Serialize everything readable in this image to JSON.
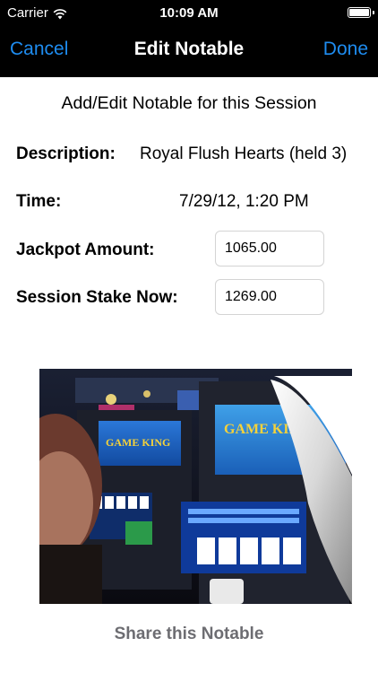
{
  "status_bar": {
    "carrier": "Carrier",
    "time": "10:09 AM",
    "battery_level": 1.0
  },
  "nav": {
    "cancel_label": "Cancel",
    "title": "Edit Notable",
    "done_label": "Done",
    "accent_color": "#1e8cf0"
  },
  "form": {
    "heading": "Add/Edit Notable for this Session",
    "description_label": "Description:",
    "description_value": "Royal Flush Hearts (held 3)",
    "time_label": "Time:",
    "time_value": "7/29/12, 1:20 PM",
    "jackpot_label": "Jackpot Amount:",
    "jackpot_value": "1065.00",
    "stake_label": "Session Stake Now:",
    "stake_value": "1269.00"
  },
  "photo": {
    "machine_sign_left": "GAME KING",
    "machine_sign_right": "GAME KING"
  },
  "share_label": "Share this Notable"
}
